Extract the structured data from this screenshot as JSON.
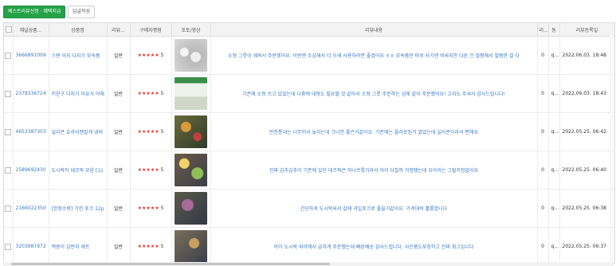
{
  "toolbar": {
    "best_review_button": "베스트리뷰선정 · 혜택지급",
    "reply_button": "답글작성"
  },
  "columns": [
    "채널상품...",
    "상품명",
    "리뷰...",
    "구매자평점",
    "포토/영상",
    "리뷰내용",
    "리...",
    "동",
    "리뷰등록일"
  ],
  "rows": [
    {
      "id": "3666891009",
      "product": "스텐 이지 다지기 부속품",
      "type": "일반",
      "stars": "★★★★★",
      "rating": "5",
      "thumb": "t1",
      "content": "소형 그릇이 깨져서 주문했어요. 이번엔 조심해서 더 오래 사용하려면 좋겠어요 ㅎㅎ 부속품만 따로 사기엔 비싸지만 다른 건 멀쩡해서 멀쩡한 걸 다",
      "c1": "0",
      "c2": "q...",
      "date": "2022.06.03. 18:48"
    },
    {
      "id": "2378336724",
      "product": "키친구 다지기 이유식 야채",
      "type": "일반",
      "stars": "★★★★★",
      "rating": "5",
      "thumb": "t2",
      "content": "기존에 소형 쓰고 있었는데 나중에 대형도 필요할 것 같아서 소형 그릇 주문하는 김에 같이 주문했어요! 고리도 주셔서 감사드립니다!",
      "c1": "0",
      "c2": "q...",
      "date": "2022.06.03. 18:43"
    },
    {
      "id": "4653387303",
      "product": "실리콘 호라이젠칼게 냉비",
      "type": "일반",
      "stars": "★★★★★",
      "rating": "5",
      "thumb": "t3",
      "content": "반찬통대는 너무커서 놓치는데 크니깐 좋은거같아요. 기존에는 플라로된거 였었는데 실리콘이라서 편해요",
      "c1": "0",
      "c2": "q...",
      "date": "2022.05.25. 06:42"
    },
    {
      "id": "2589692430",
      "product": "도시락칵 데코픽 모음 [11",
      "type": "일반",
      "stars": "★★★★★",
      "rating": "5",
      "thumb": "t4",
      "content": "진짜 김추김추이 기존에 있던 데코픽은 하나르뤘거라서 아이 다칠까 걱정됐는데 요아이는 그럴걱정없어요",
      "c1": "0",
      "c2": "q...",
      "date": "2022.05.25. 06:40"
    },
    {
      "id": "2166022350",
      "product": "[한정수량] 기린 포크 12p",
      "type": "일반",
      "stars": "★★★★★",
      "rating": "5",
      "thumb": "t5",
      "content": "간단하게 도시락싸서 갈때 과일포크로 좋을거같아요. 가격대비 훌륭합니다",
      "c1": "0",
      "c2": "q...",
      "date": "2022.05.25. 06:38"
    },
    {
      "id": "3203987972",
      "product": "백콩이 김펀치 세트",
      "type": "일반",
      "stars": "★★★★★",
      "rating": "5",
      "thumb": "t6",
      "content": "아이 도시락 싸야해서 급하게 주문했는데 빠른배송 감사드립니다. 사은품도푸짐하고 진짜 최고입니다",
      "c1": "0",
      "c2": "q...",
      "date": "2022.05.25. 06:37"
    }
  ]
}
